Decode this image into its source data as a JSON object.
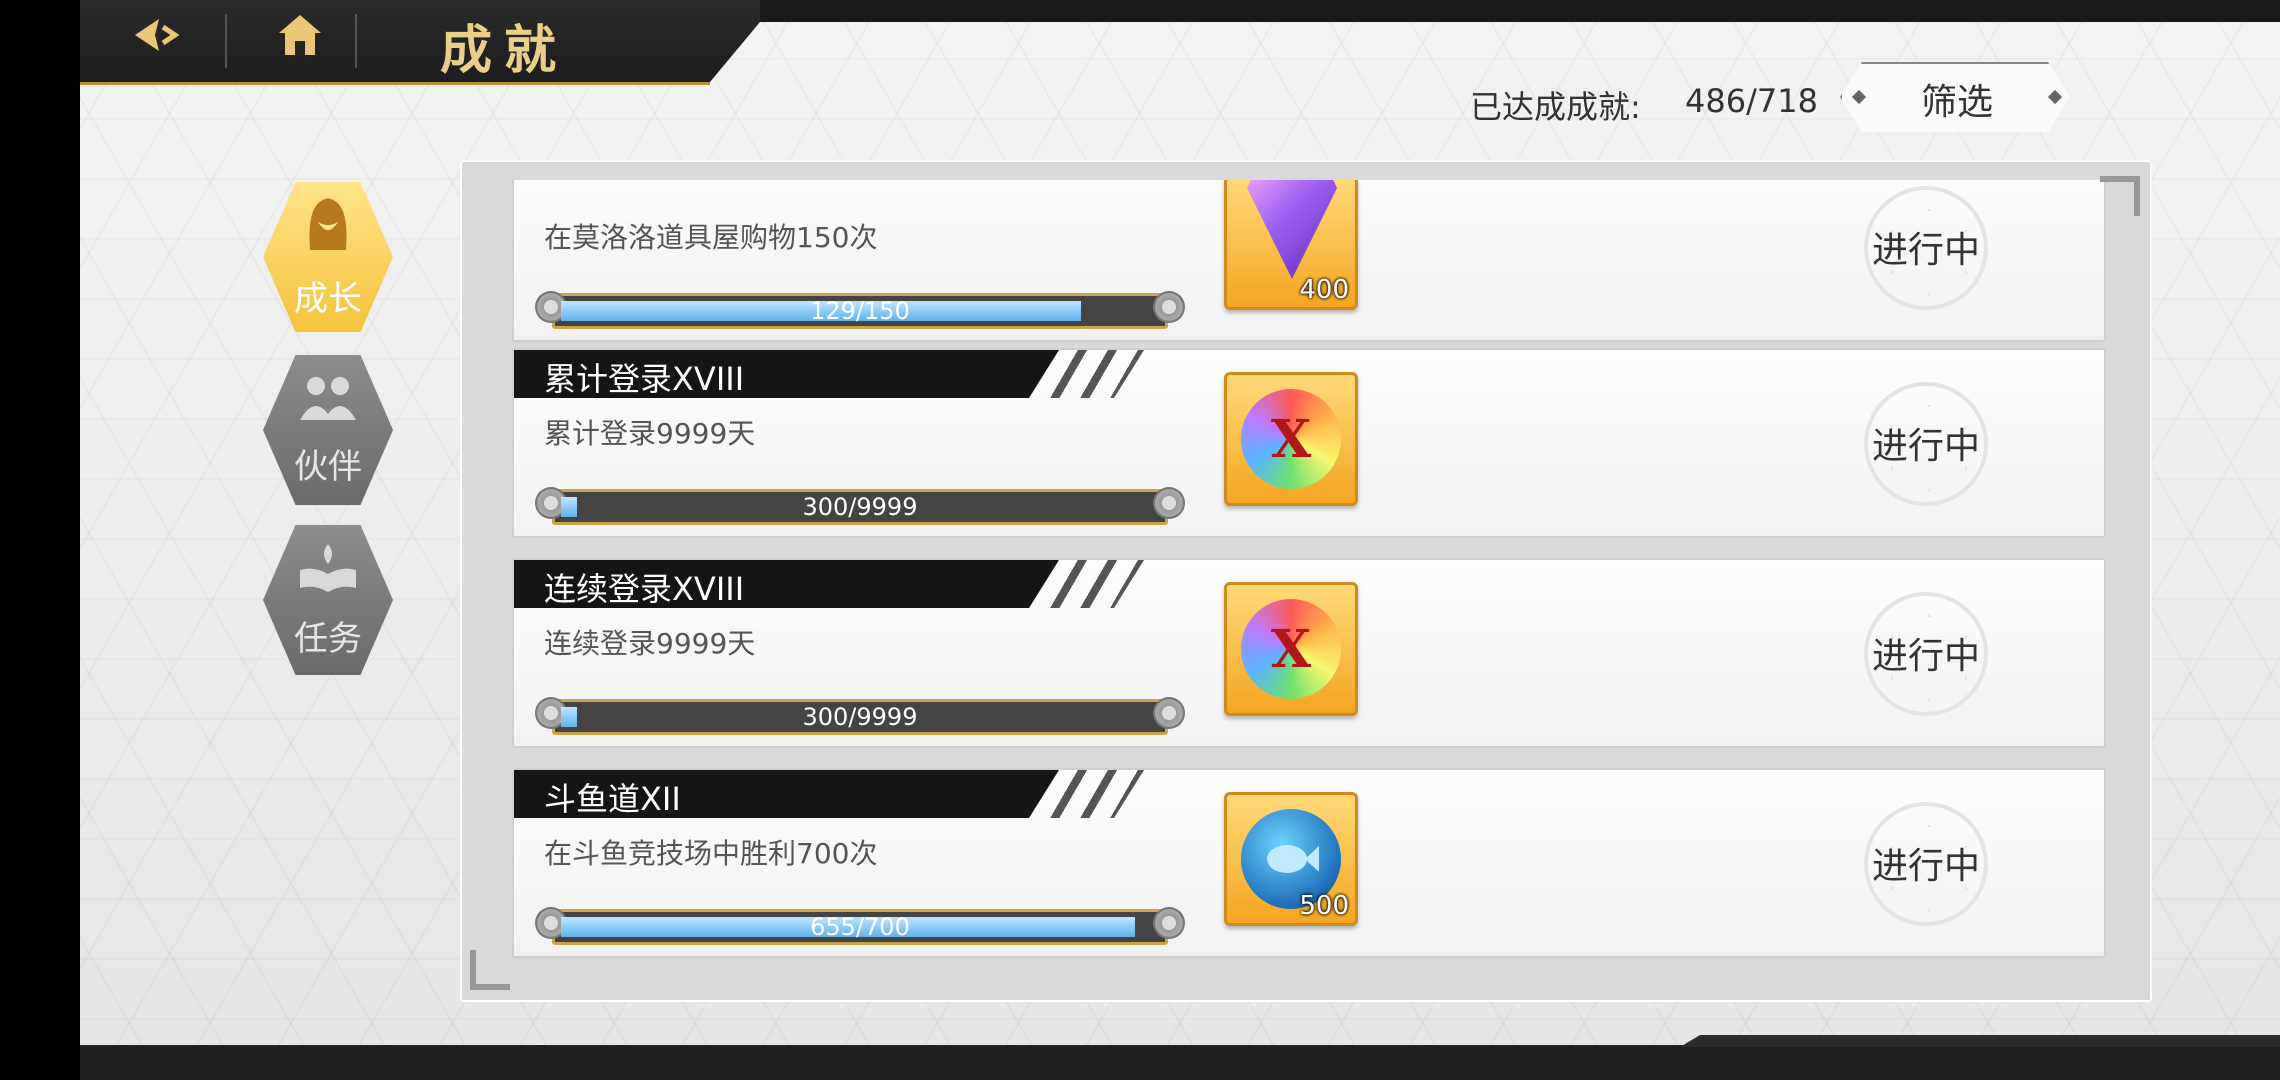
{
  "header": {
    "back_icon": "back-arrow-icon",
    "home_icon": "home-icon",
    "title": "成就"
  },
  "achievements_summary": {
    "label": "已达成成就:",
    "count": "486/718"
  },
  "filter": {
    "label": "筛选"
  },
  "side_tabs": [
    {
      "label": "成长",
      "icon": "hooded-figure-icon",
      "active": true
    },
    {
      "label": "伙伴",
      "icon": "partners-icon",
      "active": false
    },
    {
      "label": "任务",
      "icon": "open-book-flame-icon",
      "active": false
    }
  ],
  "achievement_list": [
    {
      "title": "",
      "description": "在莫洛洛道具屋购物150次",
      "progress_text": "129/150",
      "progress": 0.86,
      "reward_icon": "purple-crystal-icon",
      "reward_qty": "400",
      "status": "进行中"
    },
    {
      "title": "累计登录XVIII",
      "description": "累计登录9999天",
      "progress_text": "300/9999",
      "progress": 0.03,
      "reward_icon": "rainbow-x-medal-icon",
      "reward_qty": "",
      "status": "进行中"
    },
    {
      "title": "连续登录XVIII",
      "description": "连续登录9999天",
      "progress_text": "300/9999",
      "progress": 0.03,
      "reward_icon": "rainbow-x-medal-icon",
      "reward_qty": "",
      "status": "进行中"
    },
    {
      "title": "斗鱼道XII",
      "description": "在斗鱼竞技场中胜利700次",
      "progress_text": "655/700",
      "progress": 0.936,
      "reward_icon": "blue-fish-medal-icon",
      "reward_qty": "500",
      "status": "进行中"
    }
  ]
}
